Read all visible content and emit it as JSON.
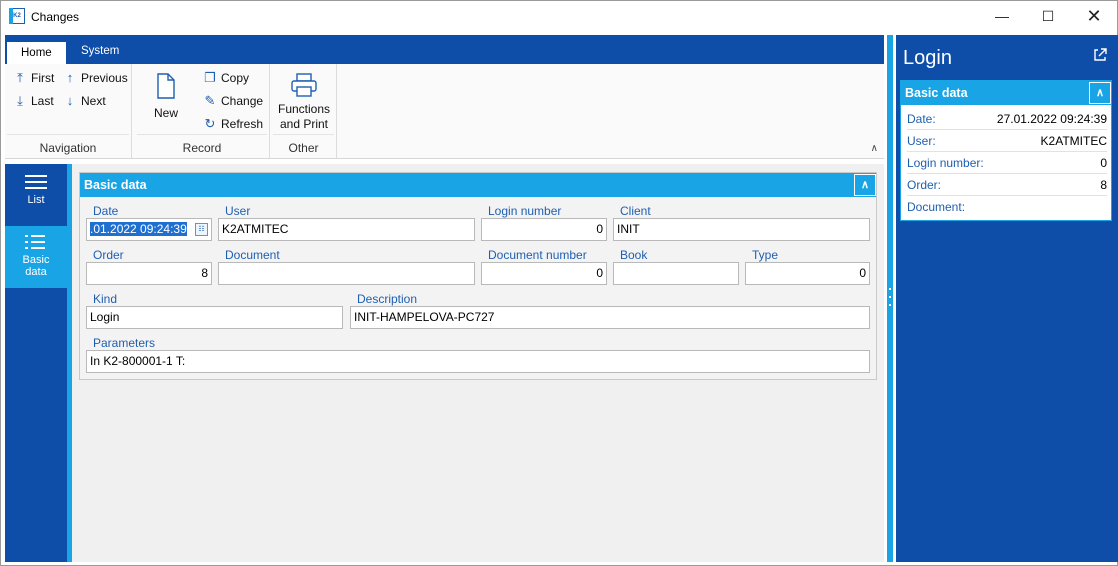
{
  "window": {
    "title": "Changes",
    "app_icon_text": "K2"
  },
  "ribbon": {
    "tabs": [
      {
        "label": "Home"
      },
      {
        "label": "System"
      }
    ],
    "navigation": {
      "first": "First",
      "previous": "Previous",
      "last": "Last",
      "next": "Next",
      "group_label": "Navigation"
    },
    "record": {
      "new": "New",
      "copy": "Copy",
      "change": "Change",
      "refresh": "Refresh",
      "group_label": "Record"
    },
    "other": {
      "functions_line1": "Functions",
      "functions_line2": "and Print",
      "group_label": "Other"
    }
  },
  "leftnav": {
    "list_label": "List",
    "basic_line1": "Basic",
    "basic_line2": "data"
  },
  "basic_data": {
    "header": "Basic data",
    "labels": {
      "date": "Date",
      "user": "User",
      "login_number": "Login number",
      "client": "Client",
      "order": "Order",
      "document": "Document",
      "document_number": "Document number",
      "book": "Book",
      "type": "Type",
      "kind": "Kind",
      "description": "Description",
      "parameters": "Parameters"
    },
    "values": {
      "date": ".01.2022 09:24:39",
      "user": "K2ATMITEC",
      "login_number": "0",
      "client": "INIT",
      "order": "8",
      "document": "",
      "document_number": "0",
      "book": "",
      "type": "0",
      "kind": "Login",
      "description": "INIT-HAMPELOVA-PC727",
      "parameters": "In K2-800001-1 T:"
    }
  },
  "side_panel": {
    "title": "Login",
    "header": "Basic data",
    "rows": [
      {
        "key": "Date:",
        "value": "27.01.2022 09:24:39"
      },
      {
        "key": "User:",
        "value": "K2ATMITEC"
      },
      {
        "key": "Login number:",
        "value": "0"
      },
      {
        "key": "Order:",
        "value": "8"
      },
      {
        "key": "Document:",
        "value": ""
      }
    ]
  },
  "colors": {
    "dark_blue": "#0e4ea8",
    "cyan": "#19a4e6",
    "label_blue": "#1f5fb0"
  }
}
